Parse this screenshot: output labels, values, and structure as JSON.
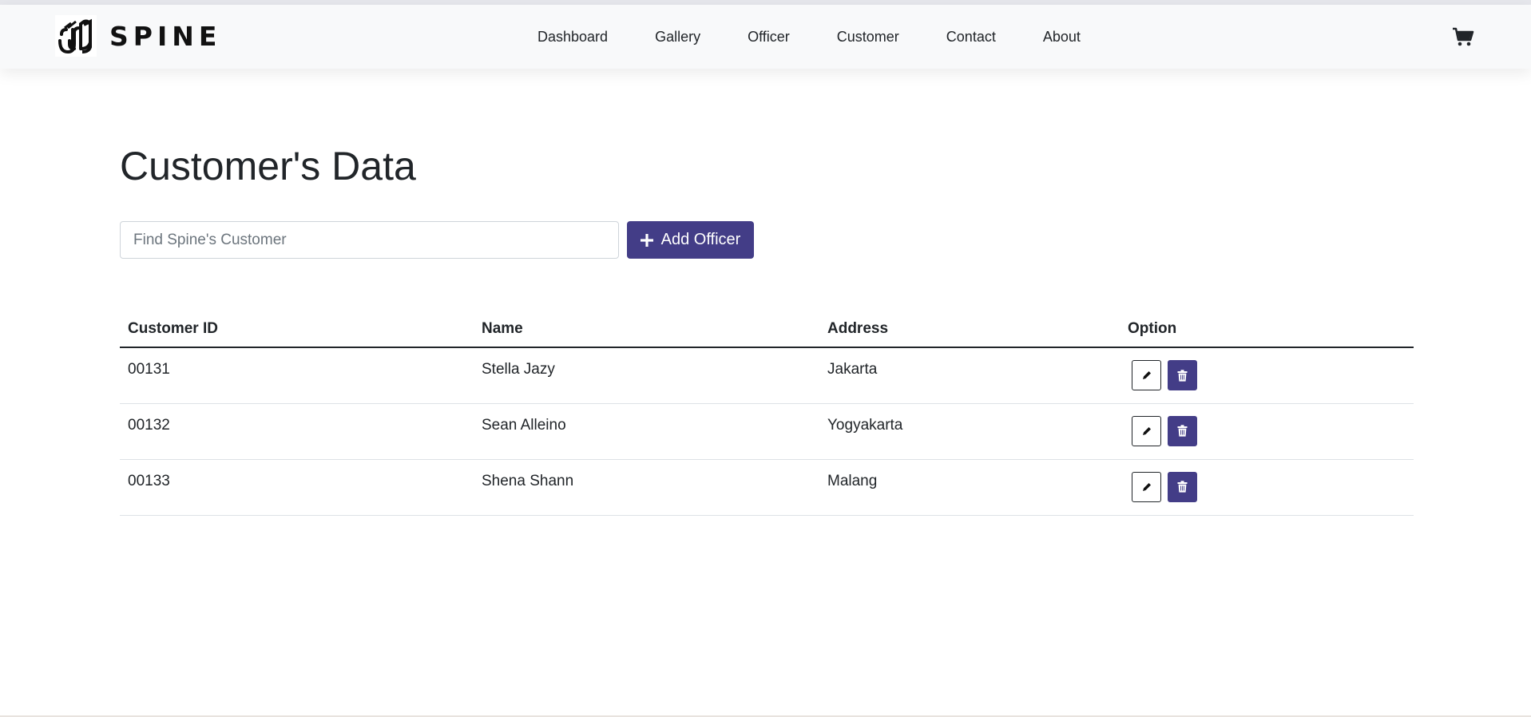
{
  "brand": {
    "name": "SPINE"
  },
  "nav": {
    "links": [
      {
        "label": "Dashboard"
      },
      {
        "label": "Gallery"
      },
      {
        "label": "Officer"
      },
      {
        "label": "Customer"
      },
      {
        "label": "Contact"
      },
      {
        "label": "About"
      }
    ],
    "cart_icon": "shopping-cart-icon"
  },
  "main": {
    "title": "Customer's Data",
    "search": {
      "placeholder": "Find Spine's Customer",
      "value": ""
    },
    "add_button": {
      "label": "Add Officer",
      "icon": "plus-icon"
    }
  },
  "table": {
    "headers": [
      "Customer ID",
      "Name",
      "Address",
      "Option"
    ],
    "rows": [
      {
        "id": "00131",
        "name": "Stella Jazy",
        "address": "Jakarta"
      },
      {
        "id": "00132",
        "name": "Sean Alleino",
        "address": "Yogyakarta"
      },
      {
        "id": "00133",
        "name": "Shena Shann",
        "address": "Malang"
      }
    ],
    "edit_icon": "pencil-icon",
    "delete_icon": "trash-icon"
  },
  "colors": {
    "accent": "#433d87",
    "navbar_bg": "#f8f9fa",
    "text": "#212529"
  }
}
